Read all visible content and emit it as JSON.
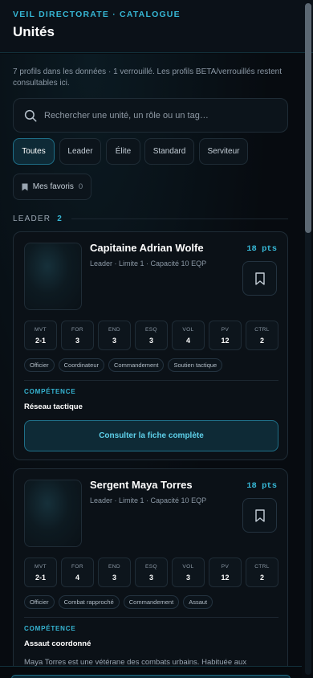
{
  "header": {
    "eyebrow": "VEIL DIRECTORATE · CATALOGUE",
    "title": "Unités"
  },
  "intro": "7 profils dans les données · 1 verrouillé. Les profils BETA/verrouillés restent consultables ici.",
  "search": {
    "placeholder": "Rechercher une unité, un rôle ou un tag…",
    "value": ""
  },
  "filters": {
    "items": [
      "Toutes",
      "Leader",
      "Élite",
      "Standard",
      "Serviteur"
    ],
    "active": "Toutes",
    "favorites_label": "Mes favoris",
    "favorites_count": "0"
  },
  "section": {
    "label": "LEADER",
    "count": "2"
  },
  "stat_labels": [
    "MVT",
    "FOR",
    "END",
    "ESQ",
    "VOL",
    "PV",
    "CTRL"
  ],
  "units": [
    {
      "name": "Capitaine Adrian Wolfe",
      "meta": "Leader · Limite 1 · Capacité 10 EQP",
      "points": "18 pts",
      "stats": [
        "2-1",
        "3",
        "3",
        "3",
        "4",
        "12",
        "2"
      ],
      "tags": [
        "Officier",
        "Coordinateur",
        "Commandement",
        "Soutien tactique"
      ],
      "competence_label": "COMPÉTENCE",
      "competence": "Réseau tactique",
      "cta": "Consulter la fiche complète"
    },
    {
      "name": "Sergent Maya Torres",
      "meta": "Leader · Limite 1 · Capacité 10 EQP",
      "points": "18 pts",
      "stats": [
        "2-1",
        "4",
        "3",
        "3",
        "3",
        "12",
        "2"
      ],
      "tags": [
        "Officier",
        "Combat rapproché",
        "Commandement",
        "Assaut"
      ],
      "competence_label": "COMPÉTENCE",
      "competence": "Assaut coordonné",
      "description": "Maya Torres est une vétérane des combats urbains. Habituée aux"
    }
  ],
  "colors": {
    "accent": "#36b6d4",
    "background": "#070b10",
    "card": "#0b1117",
    "border": "#1f2c36"
  }
}
